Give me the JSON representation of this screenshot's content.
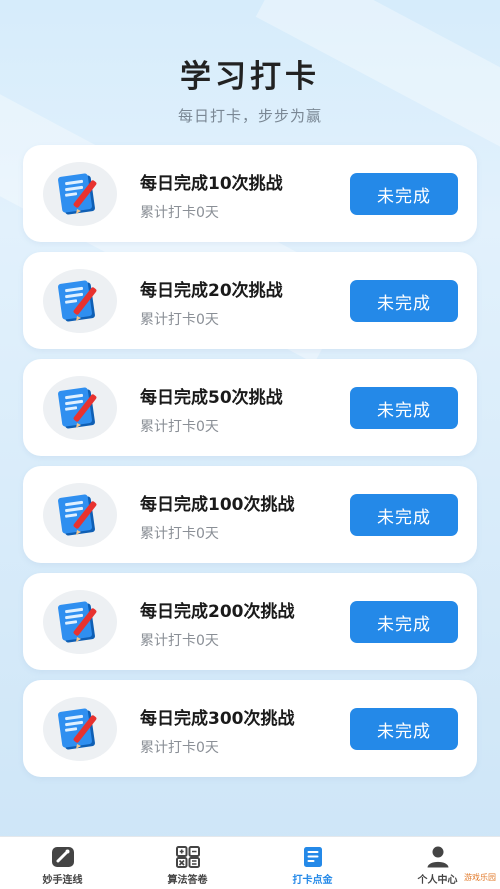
{
  "header": {
    "title": "学习打卡",
    "subtitle": "每日打卡，步步为赢"
  },
  "colors": {
    "accent": "#2489e8",
    "background": "#d6ecfb",
    "card": "#ffffff"
  },
  "cards": [
    {
      "title": "每日完成10次挑战",
      "subtitle": "累计打卡0天",
      "button": "未完成",
      "icon": "notebook-pen-icon"
    },
    {
      "title": "每日完成20次挑战",
      "subtitle": "累计打卡0天",
      "button": "未完成",
      "icon": "notebook-pen-icon"
    },
    {
      "title": "每日完成50次挑战",
      "subtitle": "累计打卡0天",
      "button": "未完成",
      "icon": "notebook-pen-icon"
    },
    {
      "title": "每日完成100次挑战",
      "subtitle": "累计打卡0天",
      "button": "未完成",
      "icon": "notebook-pen-icon"
    },
    {
      "title": "每日完成200次挑战",
      "subtitle": "累计打卡0天",
      "button": "未完成",
      "icon": "notebook-pen-icon"
    },
    {
      "title": "每日完成300次挑战",
      "subtitle": "累计打卡0天",
      "button": "未完成",
      "icon": "notebook-pen-icon"
    }
  ],
  "tabs": [
    {
      "label": "妙手连线",
      "icon": "link-icon",
      "active": false
    },
    {
      "label": "算法答卷",
      "icon": "calculator-icon",
      "active": false
    },
    {
      "label": "打卡点金",
      "icon": "checkin-book-icon",
      "active": true
    },
    {
      "label": "个人中心",
      "icon": "person-icon",
      "active": false
    }
  ],
  "watermark": "游戏乐园"
}
